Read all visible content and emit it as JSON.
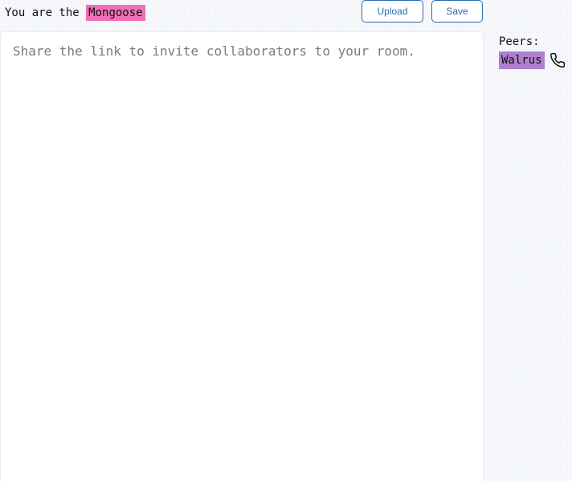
{
  "identity": {
    "prefix": "You are the ",
    "name": "Mongoose",
    "name_color": "#f16fb6"
  },
  "toolbar": {
    "upload_label": "Upload",
    "save_label": "Save",
    "accent_color": "#2b6cb0"
  },
  "editor": {
    "value": "",
    "placeholder": "Share the link to invite collaborators to your room."
  },
  "peers": {
    "title": "Peers:",
    "items": [
      {
        "name": "Walrus",
        "color": "#b07fd0",
        "action_icon": "phone-icon"
      }
    ]
  }
}
